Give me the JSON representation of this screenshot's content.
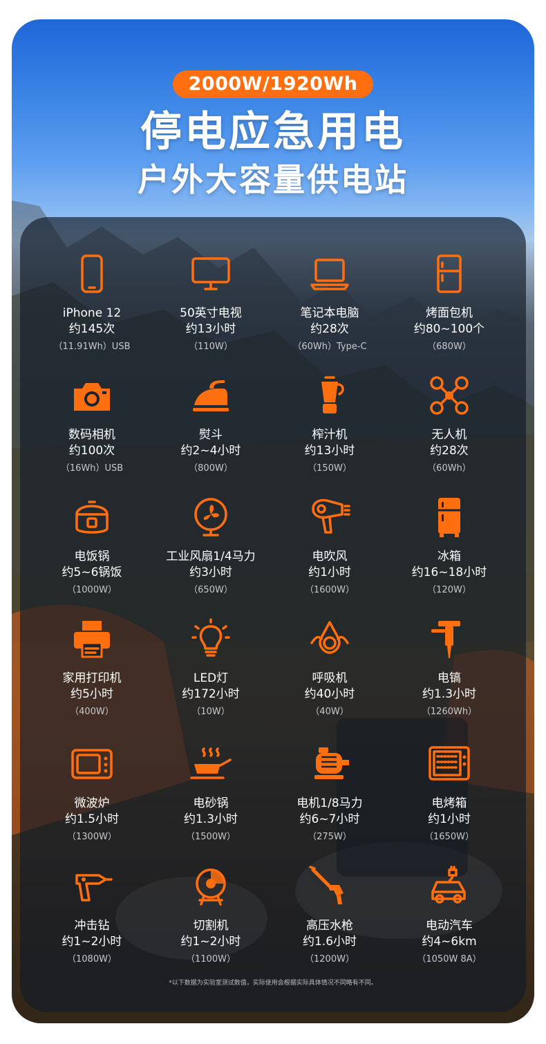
{
  "badge": "2000W/1920Wh",
  "headline": "停电应急用电",
  "subheadline": "户外大容量供电站",
  "accent_color": "#ff6f10",
  "devices": [
    {
      "name": "iPhone 12",
      "usage": "约145次",
      "spec": "（11.91Wh）USB",
      "icon": "smartphone-icon"
    },
    {
      "name": "50英寸电视",
      "usage": "约13小时",
      "spec": "（110W）",
      "icon": "tv-icon"
    },
    {
      "name": "笔记本电脑",
      "usage": "约28次",
      "spec": "（60Wh）Type-C",
      "icon": "laptop-icon"
    },
    {
      "name": "烤面包机",
      "usage": "约80~100个",
      "spec": "（680W）",
      "icon": "toaster-icon"
    },
    {
      "name": "数码相机",
      "usage": "约100次",
      "spec": "（16Wh）USB",
      "icon": "camera-icon"
    },
    {
      "name": "熨斗",
      "usage": "约2~4小时",
      "spec": "（800W）",
      "icon": "iron-icon"
    },
    {
      "name": "榨汁机",
      "usage": "约13小时",
      "spec": "（150W）",
      "icon": "juicer-icon"
    },
    {
      "name": "无人机",
      "usage": "约28次",
      "spec": "（60Wh）",
      "icon": "drone-icon"
    },
    {
      "name": "电饭锅",
      "usage": "约5~6锅饭",
      "spec": "（1000W）",
      "icon": "rice-cooker-icon"
    },
    {
      "name": "工业风扇1/4马力",
      "usage": "约3小时",
      "spec": "（650W）",
      "icon": "fan-icon"
    },
    {
      "name": "电吹风",
      "usage": "约1小时",
      "spec": "（1600W）",
      "icon": "hair-dryer-icon"
    },
    {
      "name": "冰箱",
      "usage": "约16~18小时",
      "spec": "（120W）",
      "icon": "fridge-icon"
    },
    {
      "name": "家用打印机",
      "usage": "约5小时",
      "spec": "（400W）",
      "icon": "printer-icon"
    },
    {
      "name": "LED灯",
      "usage": "约172小时",
      "spec": "（10W）",
      "icon": "bulb-icon"
    },
    {
      "name": "呼吸机",
      "usage": "约40小时",
      "spec": "（40W）",
      "icon": "ventilator-mask-icon"
    },
    {
      "name": "电镐",
      "usage": "约1.3小时",
      "spec": "（1260Wh）",
      "icon": "demolition-hammer-icon"
    },
    {
      "name": "微波炉",
      "usage": "约1.5小时",
      "spec": "（1300W）",
      "icon": "microwave-icon"
    },
    {
      "name": "电砂锅",
      "usage": "约1.3小时",
      "spec": "（1500W）",
      "icon": "pan-icon"
    },
    {
      "name": "电机1/8马力",
      "usage": "约6~7小时",
      "spec": "（275W）",
      "icon": "motor-icon"
    },
    {
      "name": "电烤箱",
      "usage": "约1小时",
      "spec": "（1650W）",
      "icon": "oven-icon"
    },
    {
      "name": "冲击钻",
      "usage": "约1~2小时",
      "spec": "（1080W）",
      "icon": "drill-icon"
    },
    {
      "name": "切割机",
      "usage": "约1~2小时",
      "spec": "（1100W）",
      "icon": "cutter-icon"
    },
    {
      "name": "高压水枪",
      "usage": "约1.6小时",
      "spec": "（1200W）",
      "icon": "pressure-washer-icon"
    },
    {
      "name": "电动汽车",
      "usage": "约4~6km",
      "spec": "（1050W  8A）",
      "icon": "ev-car-icon"
    }
  ],
  "footnote": "*以下数据为实验室测试数值，实际使用会根据实际具体情况不同略有不同。"
}
